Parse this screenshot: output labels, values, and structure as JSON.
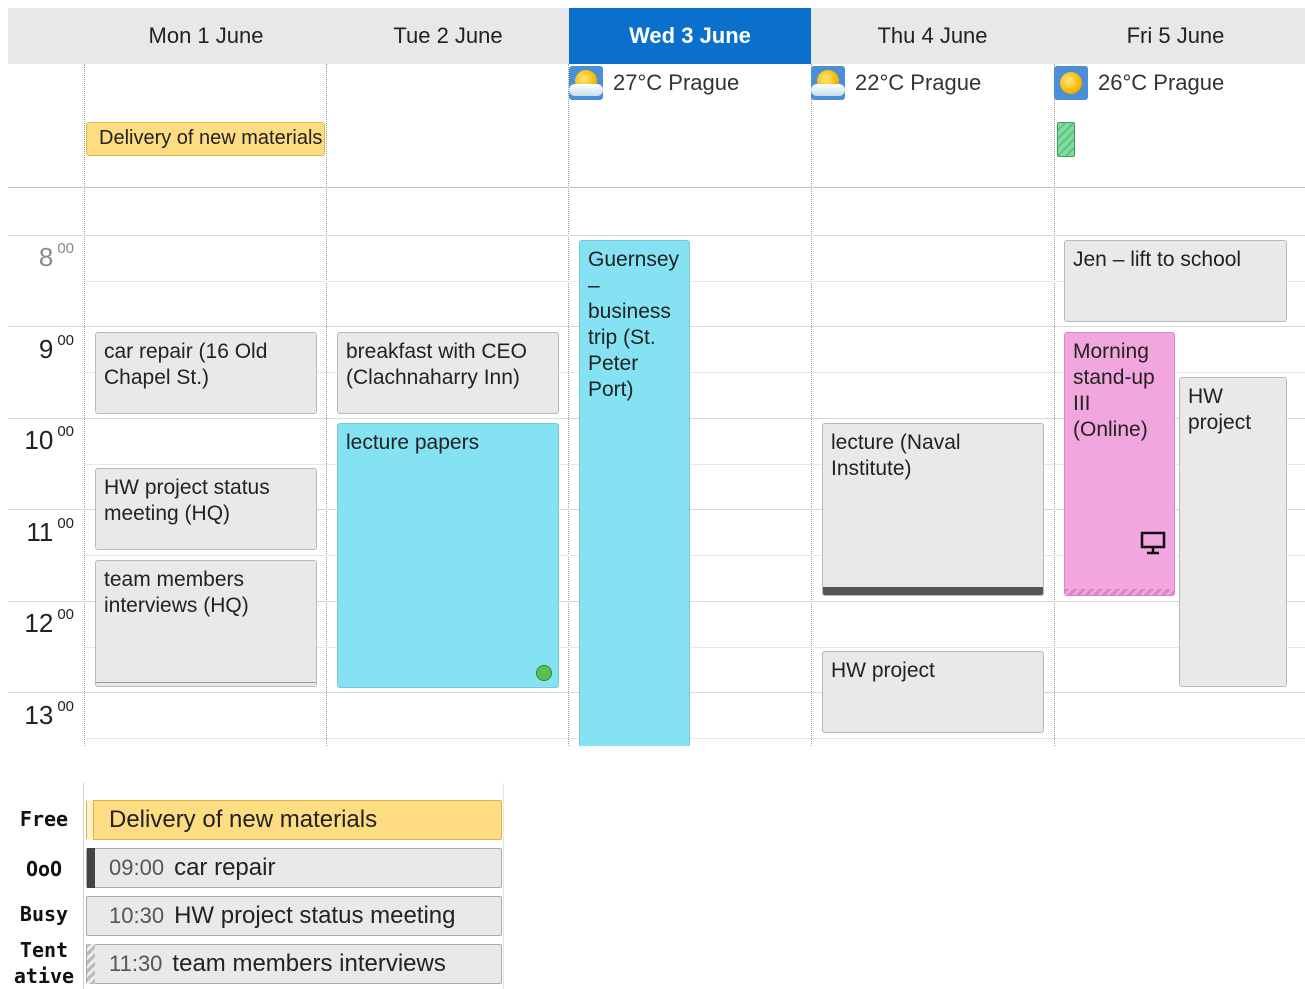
{
  "days": [
    {
      "label": "Mon 1 June"
    },
    {
      "label": "Tue 2 June"
    },
    {
      "label": "Wed 3 June",
      "today": true
    },
    {
      "label": "Thu 4 June"
    },
    {
      "label": "Fri 5 June"
    }
  ],
  "weather": {
    "wed": "27°C Prague",
    "thu": "22°C Prague",
    "fri": "26°C Prague"
  },
  "allday": {
    "mon": "Delivery of new materials"
  },
  "hours": [
    {
      "h": "8",
      "m": "00"
    },
    {
      "h": "9",
      "m": "00"
    },
    {
      "h": "10",
      "m": "00"
    },
    {
      "h": "11",
      "m": "00"
    },
    {
      "h": "12",
      "m": "00"
    },
    {
      "h": "13",
      "m": "00"
    }
  ],
  "events": {
    "mon_car_repair": "car repair (16 Old Chapel St.)",
    "mon_hw_status": "HW project status meeting (HQ)",
    "mon_team": "team members interviews (HQ)",
    "tue_breakfast": "breakfast with CEO (Clachnaharry Inn)",
    "tue_lecture_papers": "lecture papers",
    "wed_guernsey": "Guernsey – business trip (St. Peter Port)",
    "thu_lecture": "lecture (Naval Institute)",
    "thu_hw": "HW project",
    "fri_jen": "Jen – lift to school",
    "fri_standup": "Morning stand-up III (Online)",
    "fri_hw": "HW project"
  },
  "legend": [
    {
      "label": "Free",
      "time": "",
      "text": "Delivery of new materials"
    },
    {
      "label": "OoO",
      "time": "09:00",
      "text": "car repair"
    },
    {
      "label": "Busy",
      "time": "10:30",
      "text": "HW project status meeting"
    },
    {
      "label_line1": "Tent",
      "label_line2": "ative",
      "time": "11:30",
      "text": "team members interviews"
    }
  ],
  "colors": {
    "today_header": "#0a70cc",
    "free": "#fddc82",
    "tentative_cyan": "#84e2f2",
    "online_pink": "#f2a6de",
    "default_event": "#e9e9e9"
  },
  "icons": [
    "sun-cloud-icon",
    "sun-icon",
    "presentation-icon",
    "status-dot-icon"
  ]
}
